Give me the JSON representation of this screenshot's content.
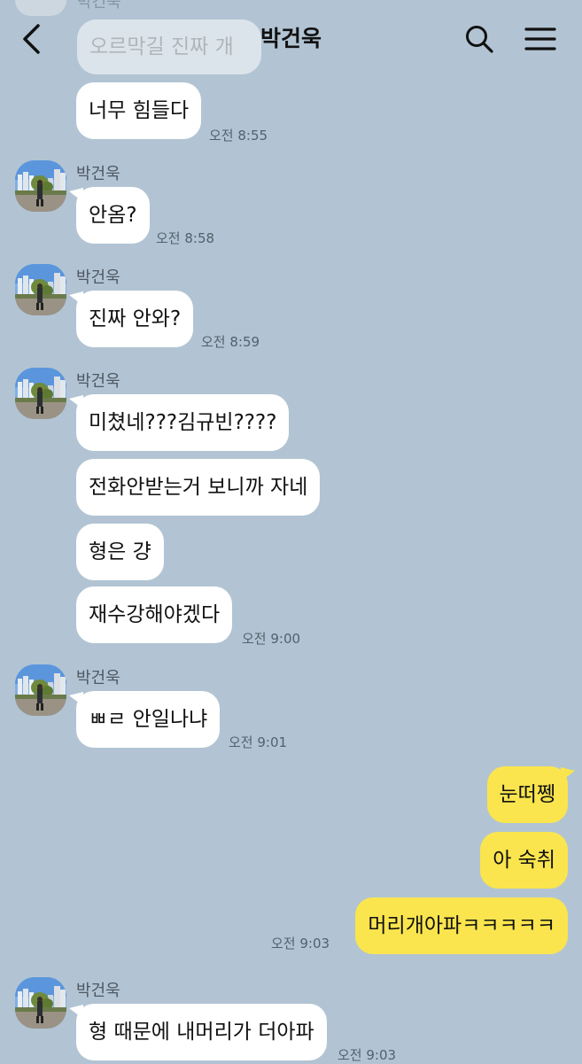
{
  "header": {
    "title": "박건욱"
  },
  "ghost": {
    "name": "박건욱",
    "text": "오르막길 진짜 개"
  },
  "messages": [
    {
      "text": "너무 힘들다",
      "time": "오전 8:55"
    },
    {
      "sender": "박건욱",
      "text": "안옴?",
      "time": "오전 8:58"
    },
    {
      "sender": "박건욱",
      "text": "진짜 안와?",
      "time": "오전 8:59"
    },
    {
      "sender": "박건욱",
      "text": "미쳤네???김규빈????"
    },
    {
      "text": "전화안받는거 보니까 자네"
    },
    {
      "text": "형은 걍"
    },
    {
      "text": "재수강해야겠다",
      "time": "오전 9:00"
    },
    {
      "sender": "박건욱",
      "text": "ㅃㄹ 안일나냐",
      "time": "오전 9:01"
    },
    {
      "text": "눈떠쩽"
    },
    {
      "text": "아 숙취"
    },
    {
      "text": "머리개아파ㅋㅋㅋㅋㅋ",
      "time": "오전 9:03"
    },
    {
      "sender": "박건욱",
      "text": "형 때문에 내머리가 더아파",
      "time": "오전 9:03"
    }
  ],
  "colors": {
    "background": "#b2c4d3",
    "incoming": "#ffffff",
    "outgoing": "#fae54e"
  },
  "icons": [
    "back-arrow-icon",
    "search-icon",
    "menu-icon"
  ]
}
